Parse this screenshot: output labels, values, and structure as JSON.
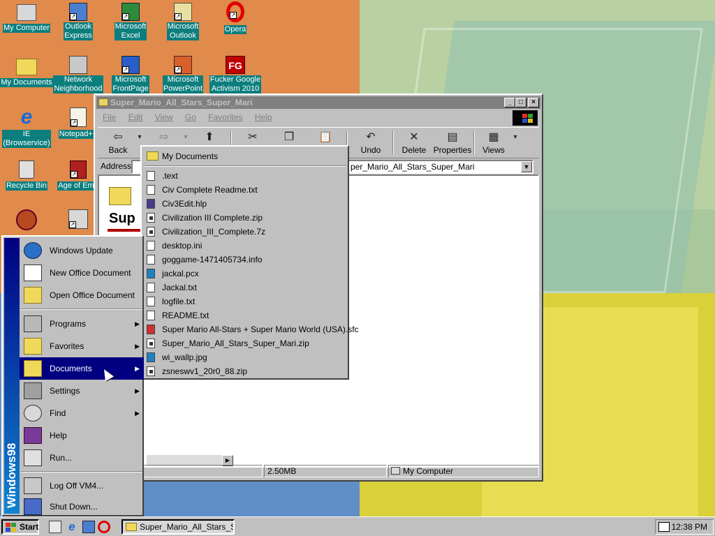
{
  "desktop": {
    "icons": [
      {
        "label1": "My Computer",
        "label2": ""
      },
      {
        "label1": "Outlook",
        "label2": "Express"
      },
      {
        "label1": "Microsoft",
        "label2": "Excel"
      },
      {
        "label1": "Microsoft",
        "label2": "Outlook"
      },
      {
        "label1": "Opera",
        "label2": ""
      },
      {
        "label1": "My Documents",
        "label2": ""
      },
      {
        "label1": "Network",
        "label2": "Neighborhood"
      },
      {
        "label1": "Microsoft",
        "label2": "FrontPage"
      },
      {
        "label1": "Microsoft",
        "label2": "PowerPoint"
      },
      {
        "label1": "Fucker Google",
        "label2": "Activism 2010"
      },
      {
        "label1": "IE",
        "label2": "(Browservice)"
      },
      {
        "label1": "Notepad++",
        "label2": ""
      },
      {
        "label1": "Recycle Bin",
        "label2": ""
      },
      {
        "label1": "Age of Emp",
        "label2": ""
      }
    ]
  },
  "window": {
    "title": "Super_Mario_All_Stars_Super_Mari",
    "minimize": "_",
    "maximize": "□",
    "close": "×",
    "menu": [
      "File",
      "Edit",
      "View",
      "Go",
      "Favorites",
      "Help"
    ],
    "toolbar": {
      "back": "Back",
      "back_icon": "⇦",
      "forward_icon": "⇨",
      "up_icon": "⬆",
      "cut_icon": "✂",
      "copy_icon": "❐",
      "paste_icon": "📋",
      "undo": "Undo",
      "undo_icon": "↶",
      "delete": "Delete",
      "delete_icon": "✕",
      "properties": "Properties",
      "properties_icon": "▤",
      "views": "Views",
      "views_icon": "▦",
      "dropdown": "▾"
    },
    "address_label": "Address",
    "address_value": "per_Mario_All_Stars_Super_Mari",
    "address_dd": "▼",
    "webview_title": "Sup",
    "scroll_right": "▶",
    "status": {
      "size": "2.50MB",
      "zone": "My Computer"
    }
  },
  "start_menu": {
    "brand": "Windows98",
    "items": [
      {
        "label": "Windows Update",
        "icon": "globe-icon"
      },
      {
        "label": "New Office Document",
        "icon": "new-document-icon"
      },
      {
        "label": "Open Office Document",
        "icon": "open-folder-icon"
      },
      {
        "label": "Programs",
        "icon": "programs-icon",
        "arrow": "▶"
      },
      {
        "label": "Favorites",
        "icon": "favorites-icon",
        "arrow": "▶"
      },
      {
        "label": "Documents",
        "icon": "documents-icon",
        "arrow": "▶"
      },
      {
        "label": "Settings",
        "icon": "settings-icon",
        "arrow": "▶"
      },
      {
        "label": "Find",
        "icon": "find-icon",
        "arrow": "▶"
      },
      {
        "label": "Help",
        "icon": "help-icon"
      },
      {
        "label": "Run...",
        "icon": "run-icon"
      },
      {
        "label": "Log Off VM4...",
        "icon": "logoff-icon"
      },
      {
        "label": "Shut Down...",
        "icon": "shutdown-icon"
      }
    ]
  },
  "documents_menu": {
    "header": "My Documents",
    "files": [
      ".text",
      "Civ Complete Readme.txt",
      "Civ3Edit.hlp",
      "Civilization III Complete.zip",
      "Civilization_III_Complete.7z",
      "desktop.ini",
      "goggame-1471405734.info",
      "jackal.pcx",
      "Jackal.txt",
      "logfile.txt",
      "README.txt",
      "Super Mario All-Stars + Super Mario World (USA).sfc",
      "Super_Mario_All_Stars_Super_Mari.zip",
      "wi_wallp.jpg",
      "zsneswv1_20r0_88.zip"
    ]
  },
  "taskbar": {
    "start": "Start",
    "task": "Super_Mario_All_Stars_Su...",
    "clock": "12:38 PM"
  },
  "colors": {
    "desktop_teal": "#0c7e7e",
    "highlight": "#000080",
    "face": "#c0c0c0"
  }
}
